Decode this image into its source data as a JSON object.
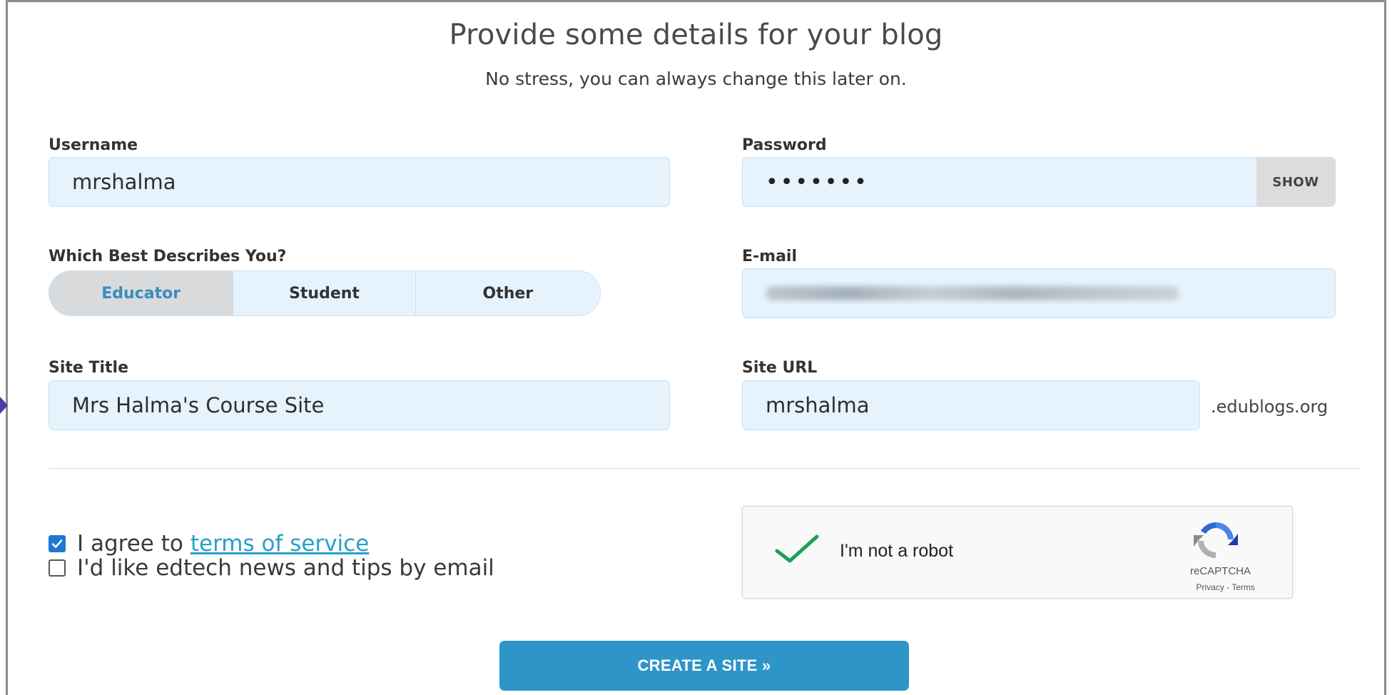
{
  "header": {
    "title": "Provide some details for your blog",
    "subtitle": "No stress, you can always change this later on."
  },
  "username": {
    "label": "Username",
    "value": "mrshalma"
  },
  "password": {
    "label": "Password",
    "masked_value": "•••••••",
    "show_label": "SHOW"
  },
  "role": {
    "label": "Which Best Describes You?",
    "options": [
      "Educator",
      "Student",
      "Other"
    ],
    "selected": "Educator"
  },
  "email": {
    "label": "E-mail",
    "value_state": "blurred"
  },
  "site_title": {
    "label": "Site Title",
    "value": "Mrs Halma's Course Site"
  },
  "site_url": {
    "label": "Site URL",
    "value": "mrshalma",
    "suffix": ".edublogs.org"
  },
  "agreements": {
    "terms": {
      "prefix": "I agree to",
      "link": "terms of service",
      "checked": true
    },
    "news": {
      "label": "I'd like edtech news and tips by email",
      "checked": false
    }
  },
  "recaptcha": {
    "label": "I'm not a robot",
    "brand": "reCAPTCHA",
    "links": "Privacy - Terms",
    "checked": true
  },
  "submit": {
    "label": "CREATE A SITE »"
  },
  "colors": {
    "input_bg": "#e6f3fd",
    "accent": "#2d95c8",
    "link": "#2a9fc9",
    "checkbox": "#1f77d4",
    "recaptcha_check": "#1e9e5a"
  },
  "icons": {
    "checkbox_checked": "checkmark-icon",
    "recaptcha_check": "green-check-icon",
    "recaptcha_logo": "recaptcha-logo-icon",
    "side_arrow": "arrow-right-icon"
  }
}
